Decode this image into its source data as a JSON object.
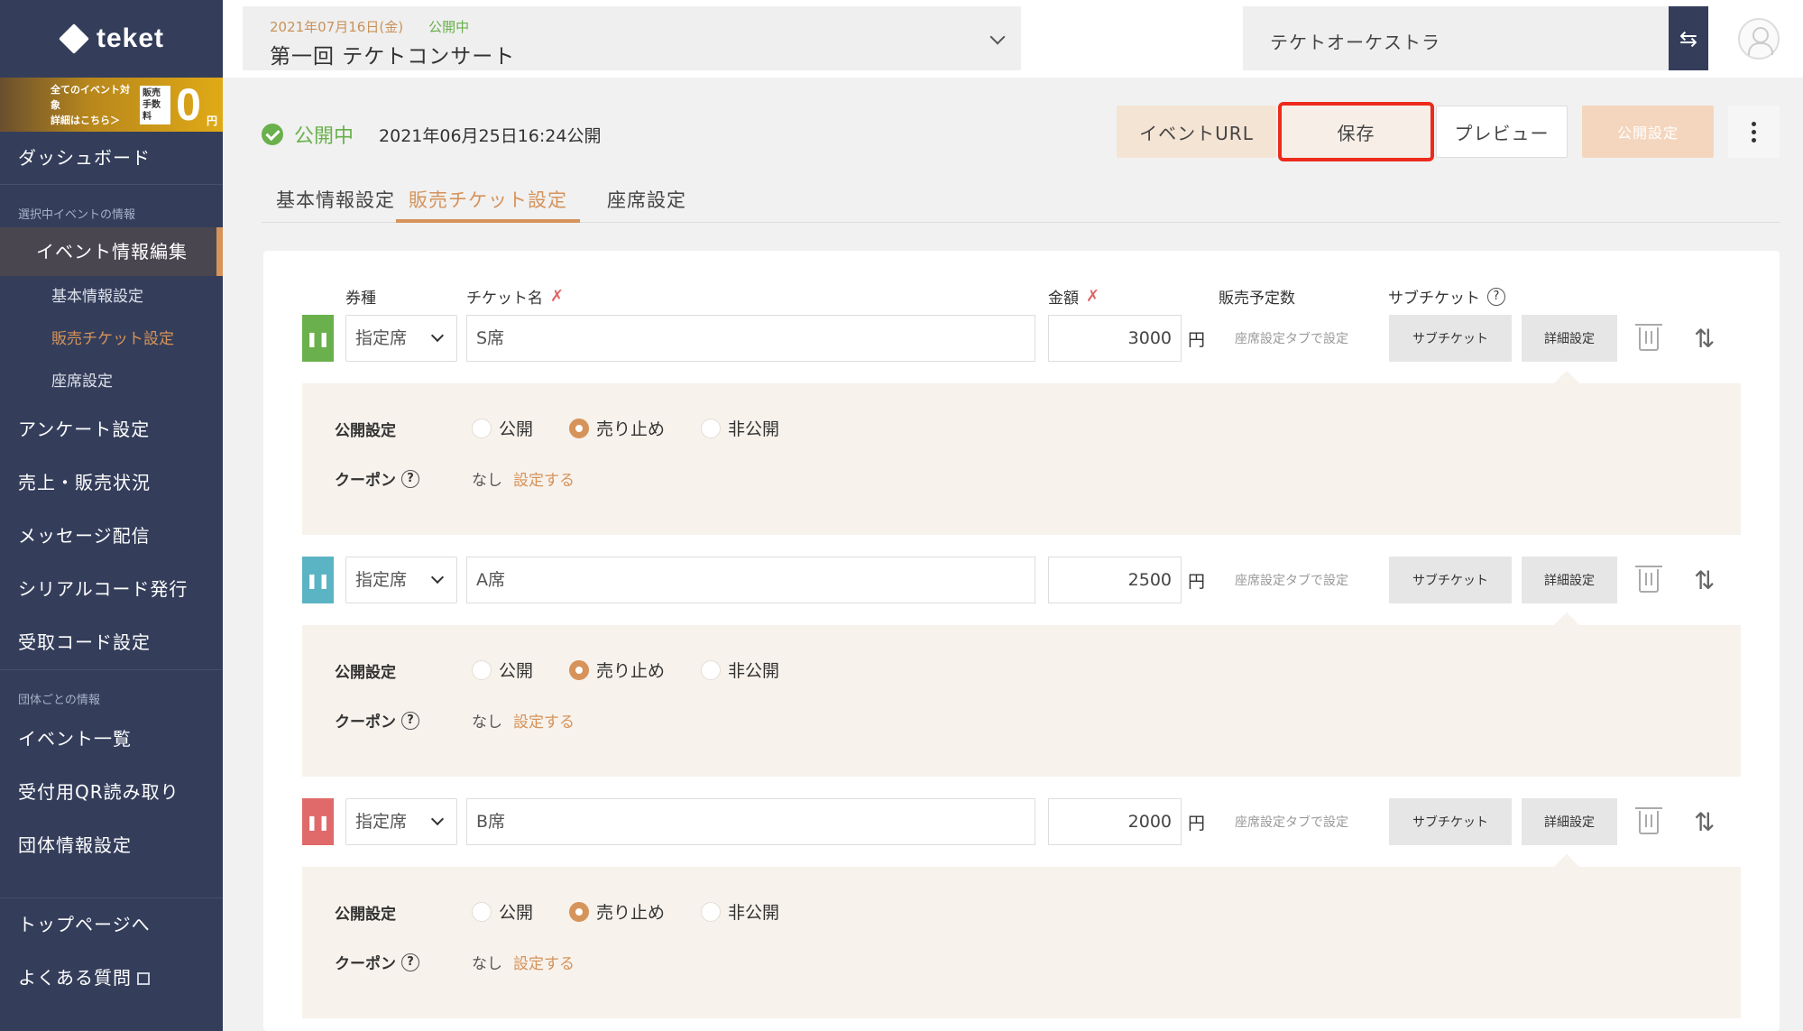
{
  "sidebar": {
    "logo": "teket",
    "promo": {
      "line1": "全てのイベント対象",
      "line2": "詳細はこちら＞",
      "fee_label": "販売手数料",
      "zero": "0",
      "yen": "円"
    },
    "dashboard": "ダッシュボード",
    "section_event": "選択中イベントの情報",
    "active_item": "イベント情報編集",
    "sub_items": [
      "基本情報設定",
      "販売チケット設定",
      "座席設定"
    ],
    "event_items": [
      "アンケート設定",
      "売上・販売状況",
      "メッセージ配信",
      "シリアルコード発行",
      "受取コード設定"
    ],
    "section_org": "団体ごとの情報",
    "org_items": [
      "イベント一覧",
      "受付用QR読み取り",
      "団体情報設定"
    ],
    "footer_items": [
      "トップページへ",
      "よくある質問"
    ]
  },
  "header": {
    "event_date": "2021年07月16日(金)",
    "event_status": "公開中",
    "event_name": "第一回 テケトコンサート",
    "org_name": "テケトオーケストラ",
    "switch_icon": "⇆"
  },
  "status": {
    "label": "公開中",
    "published": "2021年06月25日16:24公開"
  },
  "actions": {
    "url": "イベントURL",
    "save": "保存",
    "preview": "プレビュー",
    "publish": "公開設定"
  },
  "tabs": [
    "基本情報設定",
    "販売チケット設定",
    "座席設定"
  ],
  "columns": {
    "type": "券種",
    "name": "チケット名",
    "price": "金額",
    "quantity": "販売予定数",
    "subticket": "サブチケット"
  },
  "tickets": [
    {
      "color": "#6ab04c",
      "type": "指定席",
      "name": "S席",
      "price": "3000",
      "yen": "円",
      "seat_note": "座席設定タブで設定",
      "sub_btn": "サブチケット",
      "detail_btn": "詳細設定",
      "publish_label": "公開設定",
      "options": [
        "公開",
        "売り止め",
        "非公開"
      ],
      "selected": 1,
      "coupon_label": "クーポン",
      "coupon_value": "なし",
      "coupon_link": "設定する"
    },
    {
      "color": "#5bb4c4",
      "type": "指定席",
      "name": "A席",
      "price": "2500",
      "yen": "円",
      "seat_note": "座席設定タブで設定",
      "sub_btn": "サブチケット",
      "detail_btn": "詳細設定",
      "publish_label": "公開設定",
      "options": [
        "公開",
        "売り止め",
        "非公開"
      ],
      "selected": 1,
      "coupon_label": "クーポン",
      "coupon_value": "なし",
      "coupon_link": "設定する"
    },
    {
      "color": "#e06a6a",
      "type": "指定席",
      "name": "B席",
      "price": "2000",
      "yen": "円",
      "seat_note": "座席設定タブで設定",
      "sub_btn": "サブチケット",
      "detail_btn": "詳細設定",
      "publish_label": "公開設定",
      "options": [
        "公開",
        "売り止め",
        "非公開"
      ],
      "selected": 1,
      "coupon_label": "クーポン",
      "coupon_value": "なし",
      "coupon_link": "設定する"
    }
  ]
}
